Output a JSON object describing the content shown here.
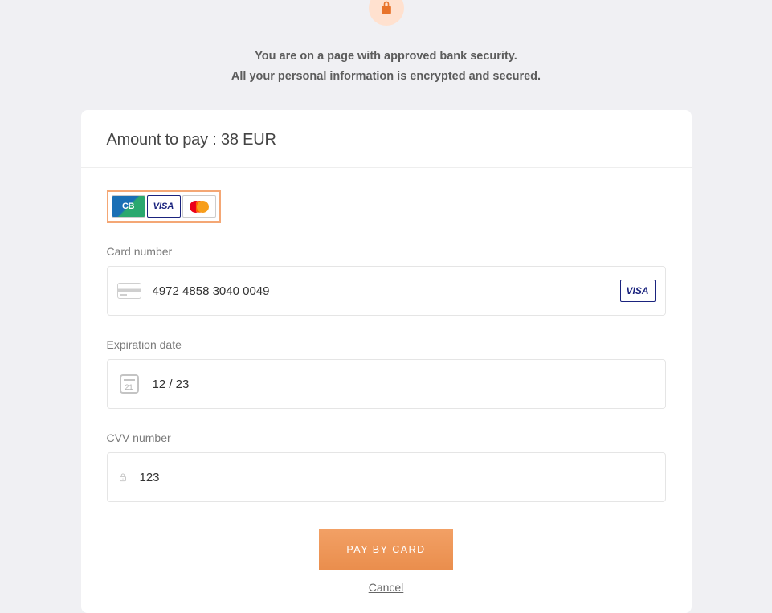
{
  "header": {
    "security_line1": "You are on a page with approved bank security.",
    "security_line2": "All your personal information is encrypted and secured."
  },
  "payment": {
    "amount_label_prefix": "Amount to pay :",
    "amount_value": "38 EUR",
    "card_brands": {
      "cb": "CB",
      "visa": "VISA",
      "mastercard": "mastercard"
    },
    "fields": {
      "card_number": {
        "label": "Card number",
        "value": "4972 4858 3040 0049",
        "detected_brand": "VISA"
      },
      "expiration": {
        "label": "Expiration date",
        "value": "12 / 23",
        "calendar_day": "21"
      },
      "cvv": {
        "label": "CVV number",
        "value": "123"
      }
    },
    "actions": {
      "pay_label": "PAY BY CARD",
      "cancel_label": "Cancel"
    }
  },
  "colors": {
    "accent": "#ec8b46",
    "lock_badge_bg": "#ffe1cf"
  }
}
